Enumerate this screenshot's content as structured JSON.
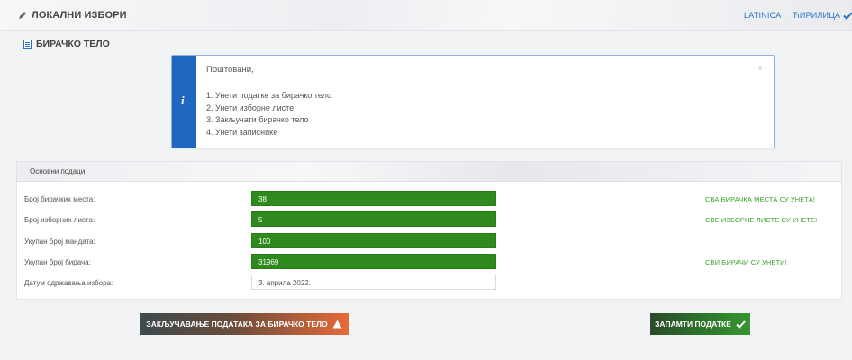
{
  "header": {
    "title": "ЛОКАЛНИ ИЗБОРИ",
    "icons": {
      "title_icon": "pencil-icon",
      "check": "checkmark-icon"
    },
    "lang_latin": "LATINICA",
    "lang_cyrillic": "ЋИРИЛИЦА"
  },
  "section": {
    "title": "БИРАЧКО ТЕЛО",
    "icon": "document-icon"
  },
  "notice": {
    "greeting": "Поштовани,",
    "steps": [
      "1. Унети податке за бирачко тело",
      "2. Унети изборне листе",
      "3. Закључати бирачко тело",
      "4. Унети записнике"
    ],
    "close": "×",
    "icon": "info-icon"
  },
  "panel": {
    "title": "Основни подаци",
    "rows": [
      {
        "label": "Број бирачких места:",
        "value": "38",
        "status": "СВА БИРАЧКА МЕСТА СУ УНЕТА!"
      },
      {
        "label": "Број изборних листа:",
        "value": "5",
        "status": "СВЕ ИЗБОРНЕ ЛИСТЕ СУ УНЕТЕ!"
      },
      {
        "label": "Укупан број мандата:",
        "value": "100",
        "status": ""
      },
      {
        "label": "Укупан број бирача:",
        "value": "31969",
        "status": "СВИ БИРАЧИ СУ УНЕТИ!"
      },
      {
        "label": "Датум одржавања избора:",
        "value": "3. априла 2022.",
        "status": ""
      }
    ]
  },
  "buttons": {
    "lock_label": "ЗАКЉУЧАВАЊЕ ПОДАТАКА ЗА БИРАЧКО ТЕЛО",
    "save_label": "ЗАПАМТИ ПОДАТКЕ"
  },
  "colors": {
    "accent_blue": "#1f67c0",
    "field_green": "#2f8a1d",
    "status_green": "#3aa22a",
    "warning_orange": "#e66a3a"
  }
}
